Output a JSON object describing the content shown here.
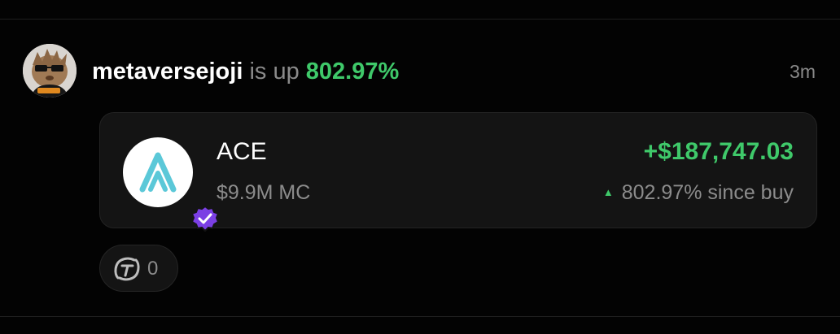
{
  "post": {
    "username": "metaversejoji",
    "verb": "is up",
    "percent": "802.97%",
    "timestamp": "3m"
  },
  "token": {
    "symbol": "ACE",
    "market_cap": "$9.9M MC",
    "gain": "+$187,747.03",
    "since_buy": "802.97% since buy",
    "logo_icon": "ace-logo-icon",
    "badge_icon": "verified-badge-icon"
  },
  "reactions": {
    "icon": "reaction-icon",
    "count": "0"
  },
  "colors": {
    "background": "#030303",
    "card": "#141414",
    "positive": "#3fc96a",
    "muted": "#8a8a8a",
    "badge": "#7b3fe4",
    "logo_accent": "#5bc8d8"
  }
}
